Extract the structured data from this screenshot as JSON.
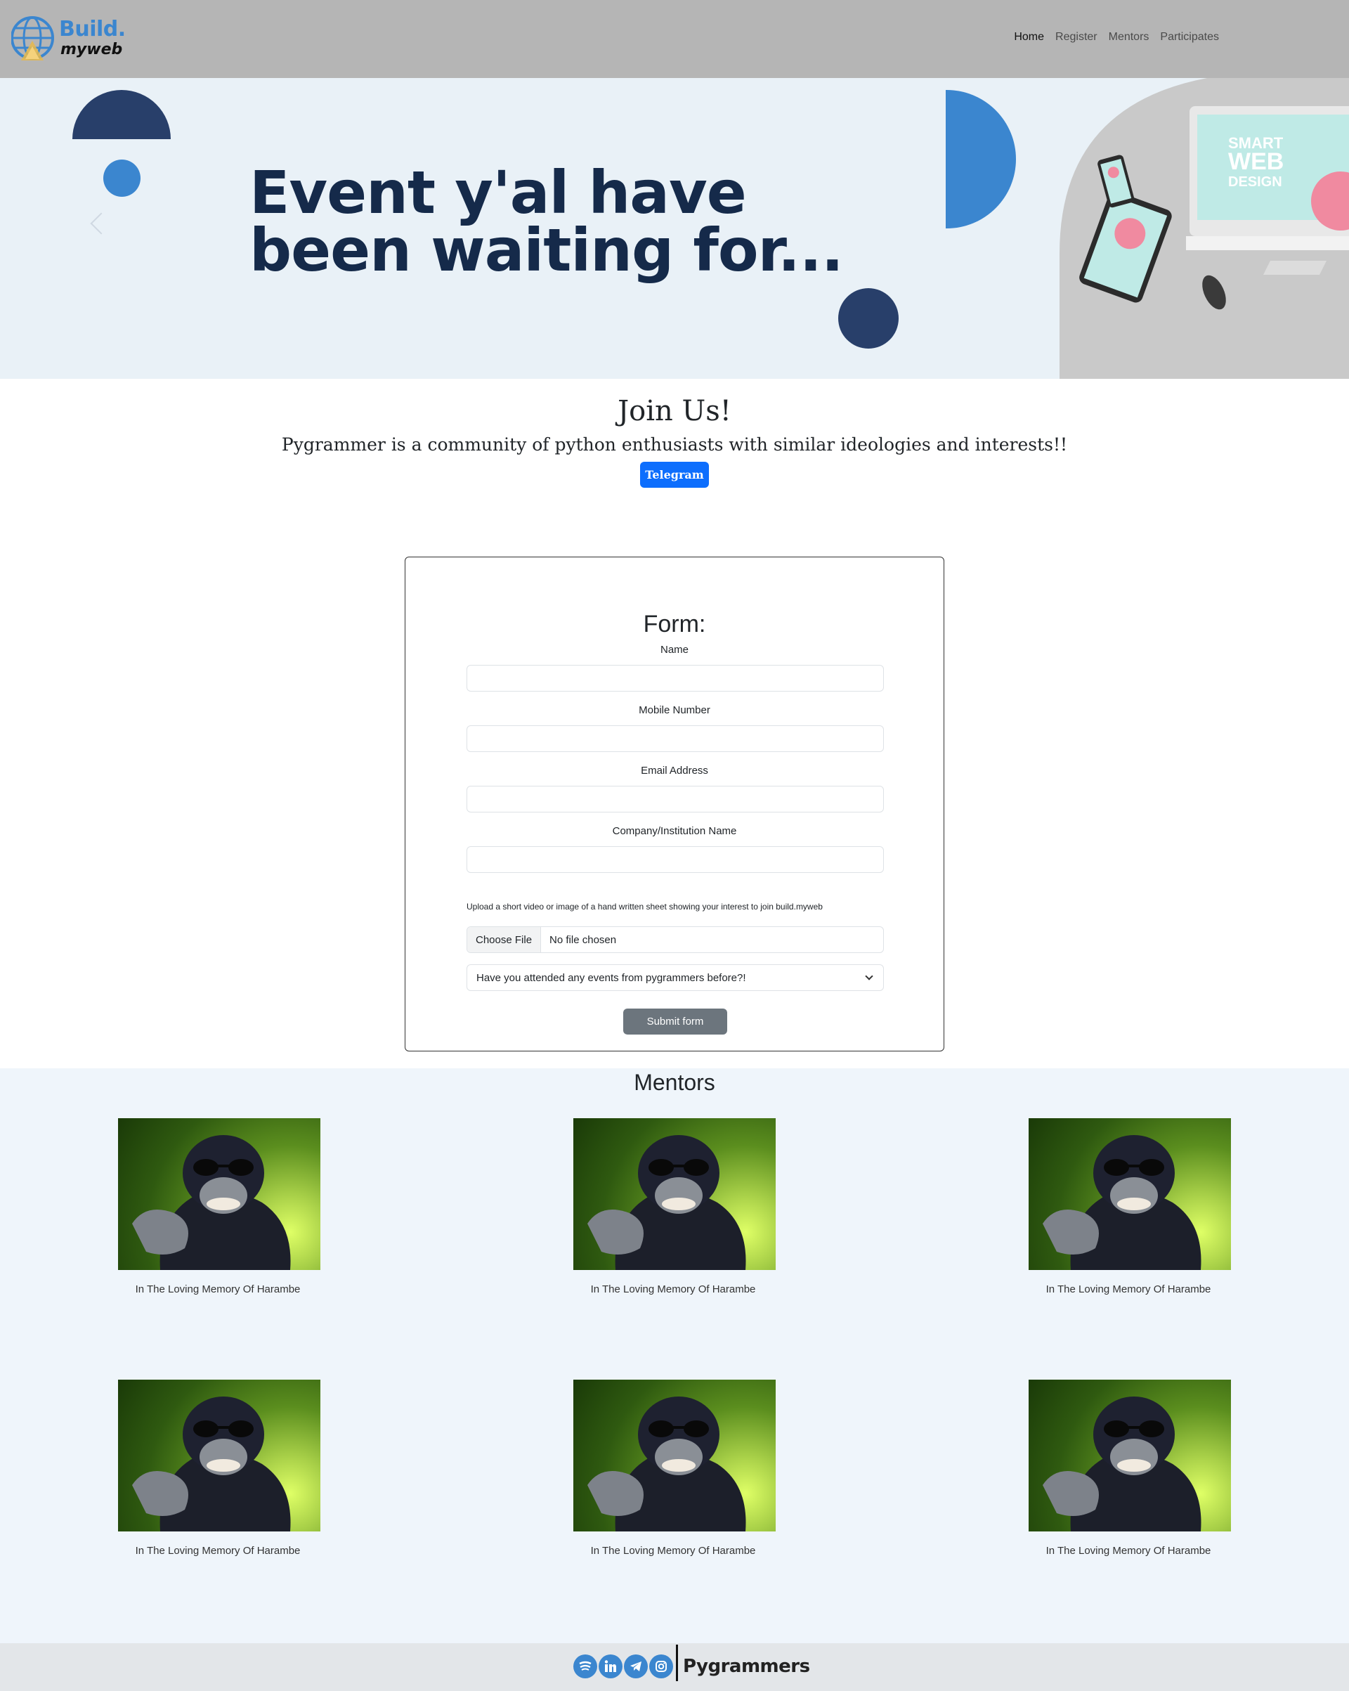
{
  "brand": {
    "line1": "Build.",
    "line2": "myweb"
  },
  "nav": {
    "items": [
      {
        "label": "Home",
        "active": true
      },
      {
        "label": "Register",
        "active": false
      },
      {
        "label": "Mentors",
        "active": false
      },
      {
        "label": "Participates",
        "active": false
      }
    ]
  },
  "hero": {
    "title_line1": "Event y'al have",
    "title_line2": "been waiting for...",
    "art": {
      "line1": "SMART",
      "line2": "WEB",
      "line3": "DESIGN"
    }
  },
  "join": {
    "title": "Join Us!",
    "subtitle": "Pygrammer is a community of python enthusiasts with similar ideologies and interests!!",
    "button": "Telegram"
  },
  "form": {
    "title": "Form:",
    "fields": [
      {
        "label": "Name",
        "value": ""
      },
      {
        "label": "Mobile Number",
        "value": ""
      },
      {
        "label": "Email Address",
        "value": ""
      },
      {
        "label": "Company/Institution Name",
        "value": ""
      }
    ],
    "upload_note": "Upload a short video or image of a hand written sheet showing your interest to join build.myweb",
    "file_button": "Choose File",
    "file_status": "No file chosen",
    "select_value": "Have you attended any events from pygrammers before?!",
    "submit": "Submit form"
  },
  "mentors": {
    "title": "Mentors",
    "items": [
      {
        "caption": "In The Loving Memory Of Harambe"
      },
      {
        "caption": "In The Loving Memory Of Harambe"
      },
      {
        "caption": "In The Loving Memory Of Harambe"
      },
      {
        "caption": "In The Loving Memory Of Harambe"
      },
      {
        "caption": "In The Loving Memory Of Harambe"
      },
      {
        "caption": "In The Loving Memory Of Harambe"
      }
    ]
  },
  "footer": {
    "icons": [
      "spotify-icon",
      "linkedin-icon",
      "telegram-icon",
      "instagram-icon"
    ],
    "brand": "Pygrammers"
  },
  "colors": {
    "navbar": "#b5b5b5",
    "hero_bg": "#e9f1f7",
    "navy": "#283f6a",
    "blue": "#3b86cf",
    "primary_button": "#0d6efd",
    "secondary_button": "#6c757d",
    "mentors_bg": "#eff5fb",
    "footer_bg": "#e3e6e9"
  }
}
